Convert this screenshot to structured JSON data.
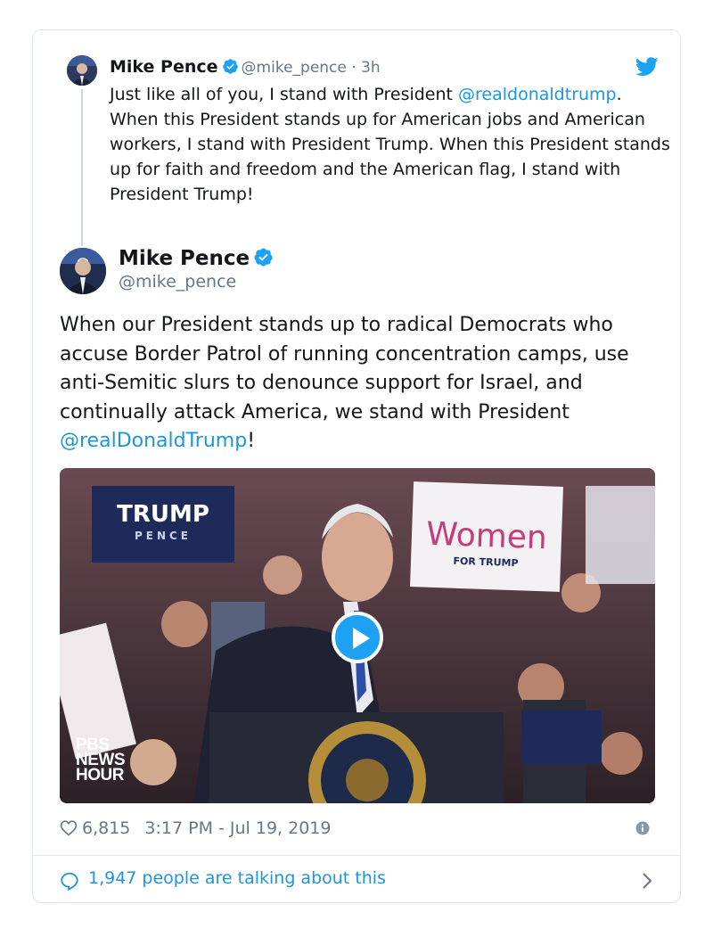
{
  "parent_tweet": {
    "name": "Mike Pence",
    "handle": "@mike_pence",
    "separator": "·",
    "time_ago": "3h",
    "text_before": "Just like all of you, I stand with President ",
    "mention": "@realdonaldtrump",
    "text_after": ". When this President stands up for American jobs and American workers, I stand with President Trump. When this President stands up for faith and freedom and the American flag, I stand with President Trump!"
  },
  "main_tweet": {
    "name": "Mike Pence",
    "handle": "@mike_pence",
    "text_before": "When our President stands up to radical Democrats who accuse Border Patrol of running concentration camps, use anti-Semitic slurs to denounce support for Israel, and continually attack America, we stand with President ",
    "mention": "@realDonaldTrump",
    "text_after": "!"
  },
  "media": {
    "credit_line1": "PBS",
    "credit_line2": "NEWS",
    "credit_line3": "HOUR",
    "sign_trump": "TRUMP",
    "sign_pence": "PENCE",
    "sign_women": "Women",
    "sign_for_trump": "FOR TRUMP"
  },
  "stats": {
    "likes": "6,815",
    "timestamp": "3:17 PM - Jul 19, 2019"
  },
  "conversation": {
    "label": "1,947 people are talking about this"
  },
  "icons": {
    "brand": "twitter-bird-icon",
    "verified": "verified-badge-icon",
    "like": "heart-icon",
    "info": "info-icon",
    "reply": "speech-bubble-icon",
    "open": "chevron-right-icon"
  },
  "colors": {
    "brand_blue": "#1da1f2",
    "link_blue": "#1b95e0",
    "text": "#14171a",
    "muted": "#657786",
    "border": "#e1e8ed"
  }
}
